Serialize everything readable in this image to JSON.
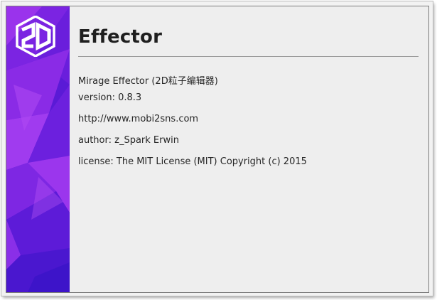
{
  "window": {
    "title": "Effector",
    "logo_text": "2D"
  },
  "about": {
    "product": "Mirage Effector (2D粒子编辑器)",
    "version": "version: 0.8.3",
    "website": "http://www.mobi2sns.com",
    "author": "author: z_Spark Erwin",
    "license": "license: The MIT License (MIT) Copyright (c) 2015"
  },
  "icons": {
    "logo": "2d-logo-icon"
  },
  "colors": {
    "sidebar_dark": "#3d14c9",
    "sidebar_mid": "#7a22e0",
    "sidebar_light": "#a238ee",
    "content_bg": "#eeeeee",
    "text": "#262626"
  }
}
